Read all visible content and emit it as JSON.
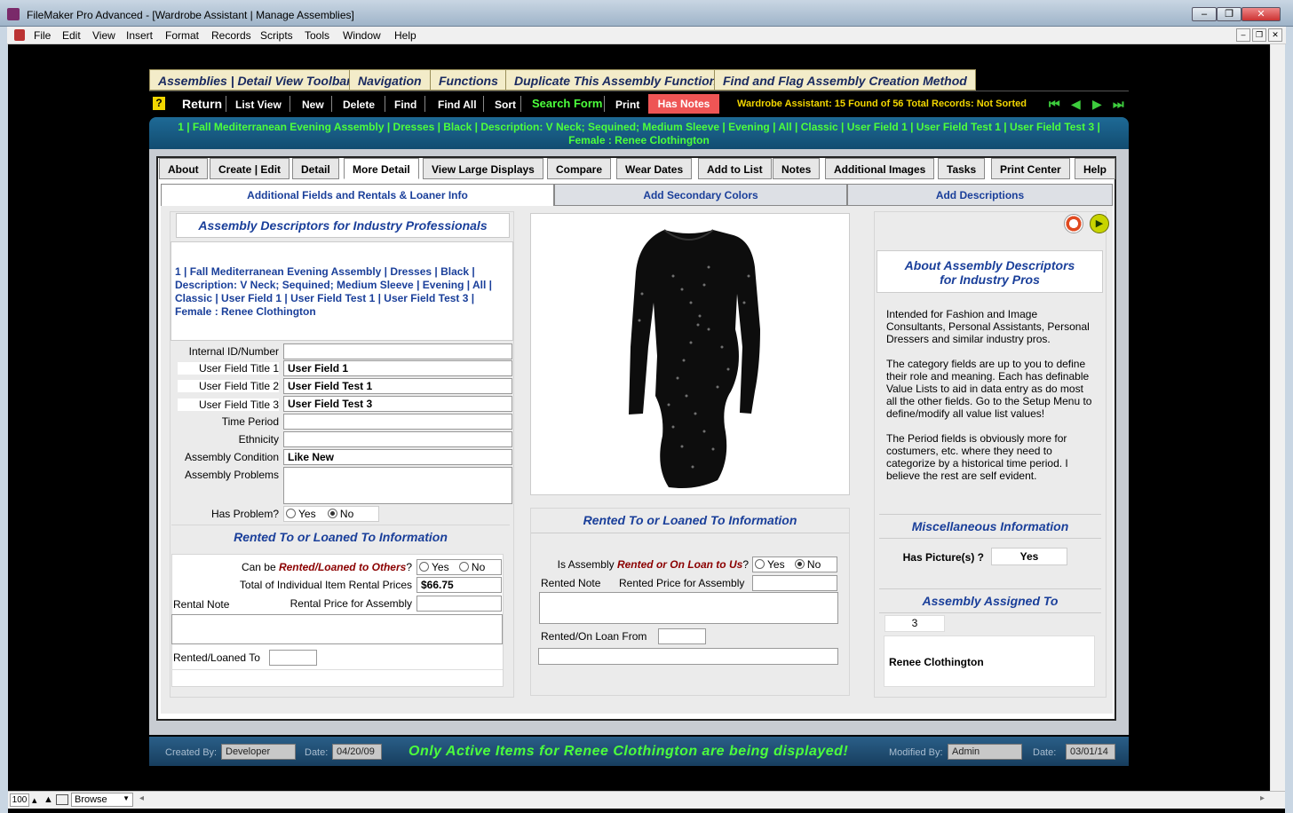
{
  "window": {
    "title": "FileMaker Pro Advanced - [Wardrobe Assistant | Manage Assemblies]"
  },
  "menu": [
    "File",
    "Edit",
    "View",
    "Insert",
    "Format",
    "Records",
    "Scripts",
    "Tools",
    "Window",
    "Help"
  ],
  "top_tabs": [
    "Assemblies | Detail View Toolbar",
    "Navigation",
    "Functions",
    "Duplicate This Assembly Function",
    "Find and Flag Assembly Creation Method"
  ],
  "toolbar": {
    "help": "?",
    "return": "Return",
    "list_view": "List View",
    "new": "New",
    "delete": "Delete",
    "find": "Find",
    "find_all": "Find All",
    "sort": "Sort",
    "search_form": "Search Form",
    "print": "Print",
    "has_notes": "Has Notes",
    "status": "Wardrobe Assistant: 15 Found of 56 Total Records: Not Sorted"
  },
  "record_summary": "1 | Fall Mediterranean Evening Assembly | Dresses | Black | Description: V Neck; Sequined; Medium Sleeve | Evening | All | Classic | User Field 1 | User Field Test 1  | User Field Test 3 | Female : Renee Clothington",
  "nav_tabs": [
    "About",
    "Create | Edit",
    "Detail",
    "More Detail",
    "View Large Displays",
    "Compare",
    "Wear Dates",
    "Add to List",
    "Notes",
    "Additional Images",
    "Tasks",
    "Print Center",
    "Help"
  ],
  "active_nav_tab": "More Detail",
  "sub_tabs": [
    "Additional Fields and Rentals & Loaner Info",
    "Add Secondary Colors",
    "Add Descriptions"
  ],
  "left": {
    "header": "Assembly Descriptors for Industry Professionals",
    "summary": "1 | Fall Mediterranean Evening Assembly | Dresses | Black | Description: V Neck; Sequined; Medium Sleeve | Evening | All | Classic | User Field 1 | User Field Test 1  | User Field Test 3 | Female : Renee Clothington",
    "fields": {
      "internal_id_label": "Internal ID/Number",
      "internal_id": "",
      "uf1_label": "User Field Title 1",
      "uf1": "User Field 1",
      "uf2_label": "User Field Title 2",
      "uf2": "User Field Test 1",
      "uf3_label": "User Field Title 3",
      "uf3": "User Field Test 3",
      "time_period_label": "Time Period",
      "time_period": "",
      "ethnicity_label": "Ethnicity",
      "ethnicity": "",
      "condition_label": "Assembly Condition",
      "condition": "Like New",
      "problems_label": "Assembly Problems",
      "problems": "",
      "has_problem_label": "Has Problem?",
      "yes": "Yes",
      "no": "No"
    },
    "rental_header": "Rented To or  Loaned To Information",
    "can_be_prefix": "Can be ",
    "can_be_emph": "Rented/Loaned to Others",
    "can_be_suffix": "?",
    "total_label": "Total of Individual Item Rental Prices",
    "total": "$66.75",
    "rental_note_label": "Rental Note",
    "rental_price_label": "Rental Price for Assembly",
    "rental_price": "",
    "rented_to_label": "Rented/Loaned To",
    "rented_to": ""
  },
  "middle": {
    "image_alt": "black sequined dress",
    "rental_header": "Rented To or  Loaned To Information",
    "is_prefix": "Is Assembly ",
    "is_emph": "Rented or On Loan to Us",
    "is_suffix": "?",
    "rented_note_label": "Rented Note",
    "rented_price_label": "Rented Price for Assembly",
    "rented_price": "",
    "rented_from_label": "Rented/On Loan From",
    "rented_from": "",
    "yes": "Yes",
    "no": "No"
  },
  "right": {
    "header_line1": "About Assembly Descriptors",
    "header_line2": "for Industry Pros",
    "p1": "Intended for Fashion and Image Consultants, Personal Assistants, Personal Dressers and similar industry pros.",
    "p2": "The category fields are up to you to define their role and meaning. Each has definable Value Lists to aid in data entry as do most all the other fields. Go to the Setup Menu to define/modify all value list values!",
    "p3": "The Period fields is obviously more for costumers, etc. where they need to categorize by a historical time period. I believe the rest are self evident.",
    "misc_header": "Miscellaneous Information",
    "has_picture_label": "Has Picture(s) ?",
    "has_picture": "Yes",
    "assigned_header": "Assembly Assigned To",
    "assigned_id": "3",
    "assigned_name": "Renee Clothington"
  },
  "footer": {
    "created_by_label": "Created By:",
    "created_by": "Developer",
    "date1_label": "Date:",
    "date1": "04/20/09",
    "message": "Only Active Items for Renee Clothington are being displayed!",
    "modified_by_label": "Modified By:",
    "modified_by": "Admin",
    "date2_label": "Date:",
    "date2": "03/01/14"
  },
  "status": {
    "zoom": "100",
    "mode": "Browse"
  },
  "colors": {
    "accent_green": "#4cff3c",
    "has_notes": "#ee5555",
    "header_blue": "#1a3f9a"
  }
}
